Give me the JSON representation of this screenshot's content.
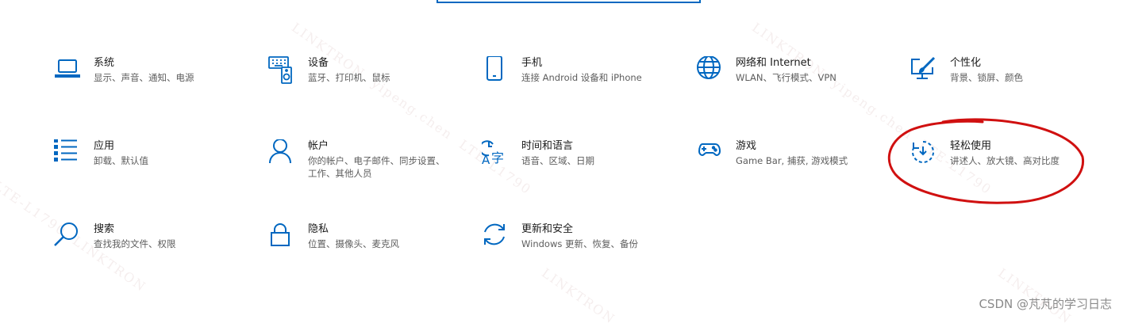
{
  "tiles": [
    {
      "title": "系统",
      "sub": "显示、声音、通知、电源",
      "icon": "laptop-icon"
    },
    {
      "title": "设备",
      "sub": "蓝牙、打印机、鼠标",
      "icon": "keyboard-speaker-icon"
    },
    {
      "title": "手机",
      "sub": "连接 Android 设备和 iPhone",
      "icon": "phone-icon"
    },
    {
      "title": "网络和 Internet",
      "sub": "WLAN、飞行模式、VPN",
      "icon": "globe-icon"
    },
    {
      "title": "个性化",
      "sub": "背景、锁屏、颜色",
      "icon": "paint-brush-icon"
    },
    {
      "title": "应用",
      "sub": "卸载、默认值",
      "icon": "app-list-icon"
    },
    {
      "title": "帐户",
      "sub": "你的帐户、电子邮件、同步设置、工作、其他人员",
      "icon": "person-icon"
    },
    {
      "title": "时间和语言",
      "sub": "语音、区域、日期",
      "icon": "time-language-icon"
    },
    {
      "title": "游戏",
      "sub": "Game Bar, 捕获, 游戏模式",
      "icon": "gamepad-icon"
    },
    {
      "title": "轻松使用",
      "sub": "讲述人、放大镜、高对比度",
      "icon": "ease-of-access-icon"
    },
    {
      "title": "搜索",
      "sub": "查找我的文件、权限",
      "icon": "search-icon"
    },
    {
      "title": "隐私",
      "sub": "位置、摄像头、麦克风",
      "icon": "lock-icon"
    },
    {
      "title": "更新和安全",
      "sub": "Windows 更新、恢复、备份",
      "icon": "sync-icon"
    }
  ],
  "watermark": {
    "line1": "LINKTRON",
    "line2": "yipeng.chen",
    "line3": "LTE-L1790"
  },
  "footer": "CSDN @芃芃的学习日志",
  "colors": {
    "accent": "#0067c0",
    "annotation": "#d01010"
  }
}
